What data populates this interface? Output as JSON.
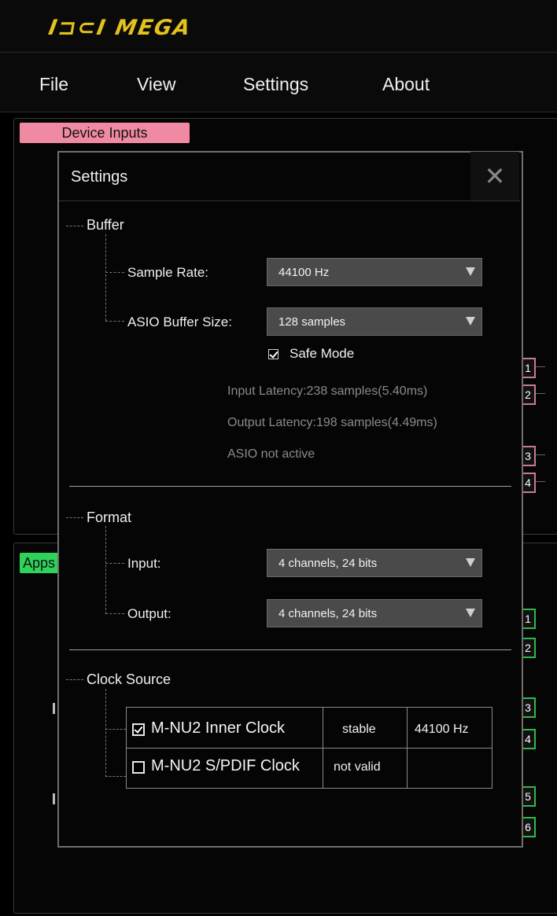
{
  "app": {
    "logo": "I⊐⊂I MEGA"
  },
  "menu": {
    "items": [
      "File",
      "View",
      "Settings",
      "About"
    ]
  },
  "panels": {
    "device_inputs_label": "Device Inputs",
    "apps_label": "Apps",
    "device_ports": [
      "1",
      "2",
      "3",
      "4"
    ],
    "app_ports": [
      "1",
      "2",
      "3",
      "4",
      "5",
      "6"
    ]
  },
  "dialog": {
    "title": "Settings",
    "close_glyph": "✕",
    "buffer": {
      "title": "Buffer",
      "sample_rate_label": "Sample Rate:",
      "sample_rate_value": "44100 Hz",
      "asio_label": "ASIO Buffer Size:",
      "asio_value": "128  samples",
      "safe_mode_label": "Safe Mode",
      "safe_mode_checked": true,
      "input_latency": "Input Latency:238 samples(5.40ms)",
      "output_latency": "Output Latency:198 samples(4.49ms)",
      "asio_status": "ASIO not active"
    },
    "format": {
      "title": "Format",
      "input_label": "Input:",
      "input_value": "4  channels, 24 bits",
      "output_label": "Output:",
      "output_value": "4  channels, 24 bits"
    },
    "clock": {
      "title": "Clock Source",
      "rows": [
        {
          "name": "M-NU2 Inner Clock",
          "status": "stable",
          "rate": "44100 Hz",
          "checked": true
        },
        {
          "name": "M-NU2 S/PDIF Clock",
          "status": "not valid",
          "rate": "",
          "checked": false
        }
      ]
    }
  }
}
